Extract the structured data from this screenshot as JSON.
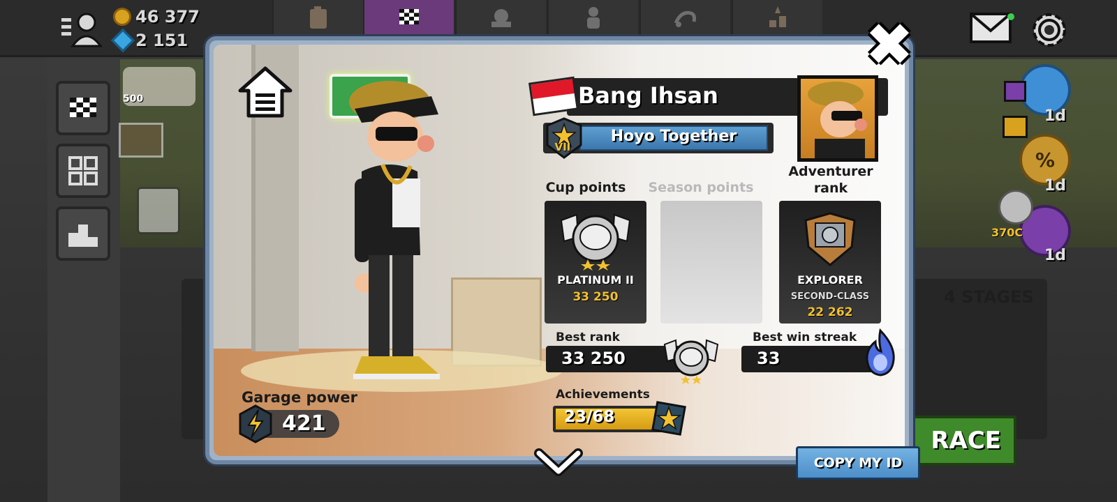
{
  "topbar": {
    "coins": "46 377",
    "gems": "2 151",
    "tabs": [
      {
        "icon": "fuel-can-icon",
        "active": false
      },
      {
        "icon": "checkered-flag-icon",
        "active": true
      },
      {
        "icon": "team-icon",
        "active": false
      },
      {
        "icon": "character-icon",
        "active": false
      },
      {
        "icon": "vehicle-icon",
        "active": false
      },
      {
        "icon": "shop-icon",
        "active": false
      }
    ]
  },
  "background": {
    "chest_label": "500",
    "side_badge_labels": [
      "1d",
      "1d",
      "1d"
    ],
    "cup_counter": "370C",
    "stages_label": "4 STAGES",
    "race_button": "RACE"
  },
  "profile": {
    "player_name": "Bang Ihsan",
    "team_name": "Hoyo Together",
    "team_level": "VII",
    "garage_power_label": "Garage power",
    "garage_power": "421",
    "cup_points_label": "Cup points",
    "cup_rank": "PLATINUM II",
    "cup_points": "33 250",
    "season_points_label": "Season points",
    "adventurer_rank_label": "Adventurer rank",
    "adventurer_rank": "EXPLORER",
    "adventurer_subrank": "SECOND-CLASS",
    "adventurer_points": "22 262",
    "best_rank_label": "Best rank",
    "best_rank": "33 250",
    "best_win_streak_label": "Best win streak",
    "best_win_streak": "33",
    "achievements_label": "Achievements",
    "achievements": "23/68",
    "copy_id_button": "COPY MY ID"
  },
  "colors": {
    "modal_border": "#6f86a3",
    "team_bar": "#4f8ec4",
    "active_tab": "#6a3a7a",
    "gold": "#f2c12e",
    "flag_red": "#e1182a"
  }
}
